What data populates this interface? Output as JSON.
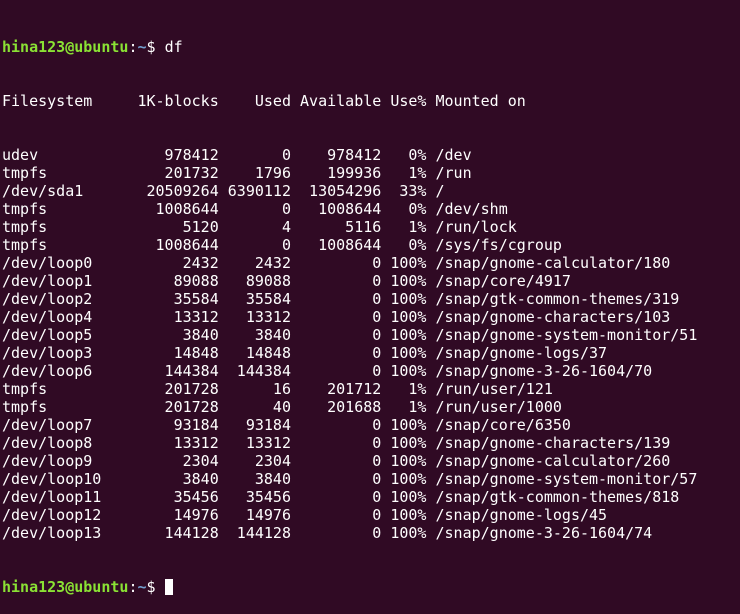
{
  "prompt": {
    "user_host": "hina123@ubuntu",
    "separator": ":",
    "path": "~",
    "symbol": "$ "
  },
  "command": "df",
  "header": "Filesystem     1K-blocks    Used Available Use% Mounted on",
  "rows": [
    "udev              978412       0    978412   0% /dev",
    "tmpfs             201732    1796    199936   1% /run",
    "/dev/sda1       20509264 6390112  13054296  33% /",
    "tmpfs            1008644       0   1008644   0% /dev/shm",
    "tmpfs               5120       4      5116   1% /run/lock",
    "tmpfs            1008644       0   1008644   0% /sys/fs/cgroup",
    "/dev/loop0          2432    2432         0 100% /snap/gnome-calculator/180",
    "/dev/loop1         89088   89088         0 100% /snap/core/4917",
    "/dev/loop2         35584   35584         0 100% /snap/gtk-common-themes/319",
    "/dev/loop4         13312   13312         0 100% /snap/gnome-characters/103",
    "/dev/loop5          3840    3840         0 100% /snap/gnome-system-monitor/51",
    "/dev/loop3         14848   14848         0 100% /snap/gnome-logs/37",
    "/dev/loop6        144384  144384         0 100% /snap/gnome-3-26-1604/70",
    "tmpfs             201728      16    201712   1% /run/user/121",
    "tmpfs             201728      40    201688   1% /run/user/1000",
    "/dev/loop7         93184   93184         0 100% /snap/core/6350",
    "/dev/loop8         13312   13312         0 100% /snap/gnome-characters/139",
    "/dev/loop9          2304    2304         0 100% /snap/gnome-calculator/260",
    "/dev/loop10         3840    3840         0 100% /snap/gnome-system-monitor/57",
    "/dev/loop11        35456   35456         0 100% /snap/gtk-common-themes/818",
    "/dev/loop12        14976   14976         0 100% /snap/gnome-logs/45",
    "/dev/loop13       144128  144128         0 100% /snap/gnome-3-26-1604/74"
  ],
  "colors": {
    "background": "#300a24",
    "text": "#ffffff",
    "prompt_user": "#8ae234",
    "prompt_path": "#729fcf"
  }
}
